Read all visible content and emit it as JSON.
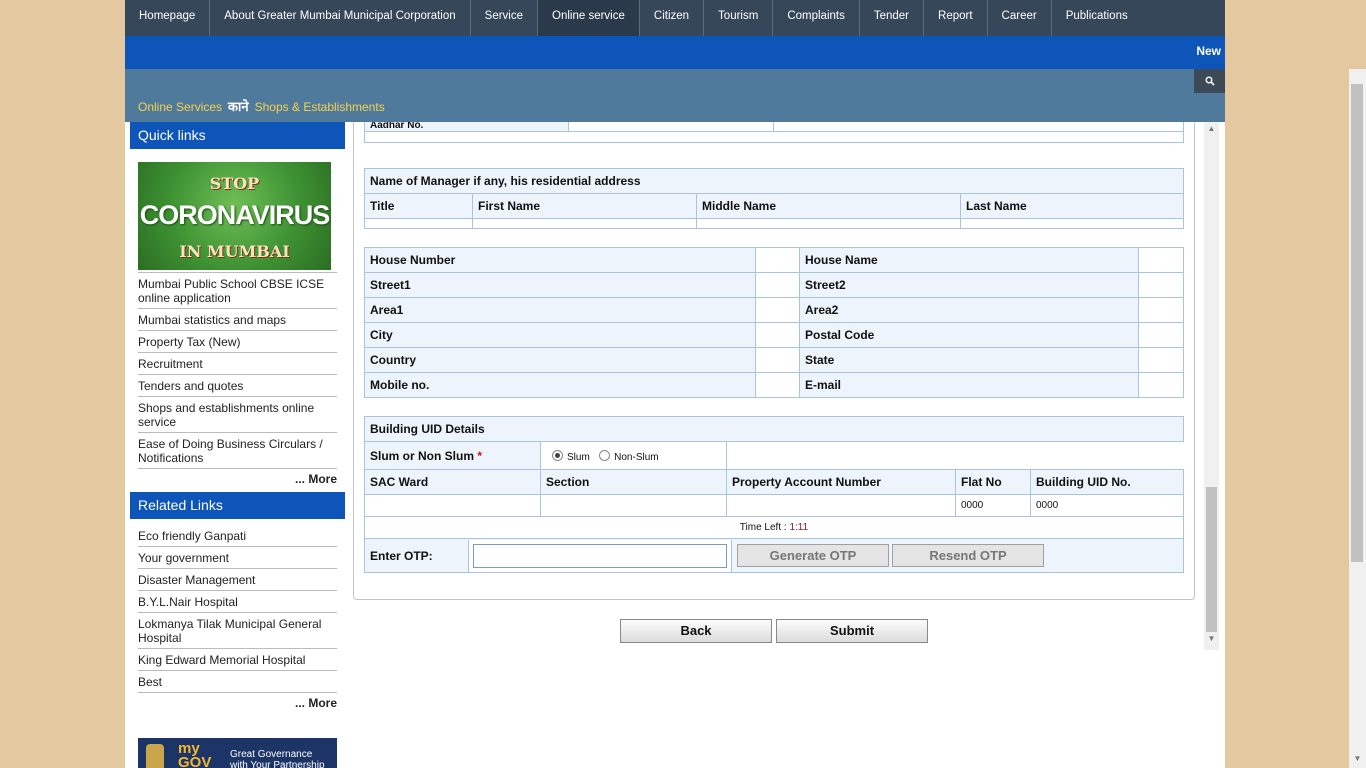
{
  "nav": {
    "items": [
      "Homepage",
      "About Greater Mumbai Municipal Corporation",
      "Service",
      "Online service",
      "Citizen",
      "Tourism",
      "Complaints",
      "Tender",
      "Report",
      "Career",
      "Publications"
    ],
    "active_index": 3
  },
  "marquee": {
    "text": "New"
  },
  "breadcrumb": {
    "part1": "Online Services",
    "separator": "काने",
    "part2": "Shops & Establishments"
  },
  "quick_links": {
    "title": "Quick links",
    "banner": {
      "top": "STOP",
      "main": "CORONAVIRUS",
      "bottom": "IN MUMBAI"
    },
    "items": [
      "Mumbai Public School CBSE ICSE online application",
      "Mumbai statistics and maps",
      "Property Tax (New)",
      "Recruitment",
      "Tenders and quotes",
      "Shops and establishments online service",
      "Ease of Doing Business Circulars / Notifications"
    ],
    "more": "... More"
  },
  "related_links": {
    "title": "Related Links",
    "items": [
      "Eco friendly Ganpati",
      "Your government",
      "Disaster Management",
      "B.Y.L.Nair Hospital",
      "Lokmanya Tilak Municipal General Hospital",
      "King Edward Memorial Hospital",
      "Best"
    ],
    "more": "... More"
  },
  "mygov": {
    "logo_line1": "my",
    "logo_line2": "GOV",
    "tagline_line1": "Great Governance",
    "tagline_line2": "with Your Partnership"
  },
  "form": {
    "aadhar_label": "Aadhar No.",
    "manager": {
      "heading": "Name of Manager if any, his residential address",
      "title": "Title",
      "first_name": "First Name",
      "middle_name": "Middle Name",
      "last_name": "Last Name"
    },
    "address": {
      "house_number": "House Number",
      "house_name": "House Name",
      "street1": "Street1",
      "street2": "Street2",
      "area1": "Area1",
      "area2": "Area2",
      "city": "City",
      "postal_code": "Postal Code",
      "country": "Country",
      "state": "State",
      "mobile": "Mobile no.",
      "email": "E-mail"
    },
    "building": {
      "heading": "Building UID Details",
      "slum_label": "Slum or Non Slum",
      "required_mark": "*",
      "slum_option": "Slum",
      "non_slum_option": "Non-Slum",
      "sac_ward": "SAC Ward",
      "section": "Section",
      "property_account": "Property Account Number",
      "flat_no": "Flat No",
      "building_uid": "Building UID No.",
      "flat_no_value": "0000",
      "building_uid_value": "0000"
    },
    "timer": {
      "label": "Time Left : ",
      "value": "1:11"
    },
    "otp": {
      "label": "Enter OTP:",
      "value": "",
      "generate": "Generate OTP",
      "resend": "Resend OTP"
    }
  },
  "buttons": {
    "back": "Back",
    "submit": "Submit"
  }
}
